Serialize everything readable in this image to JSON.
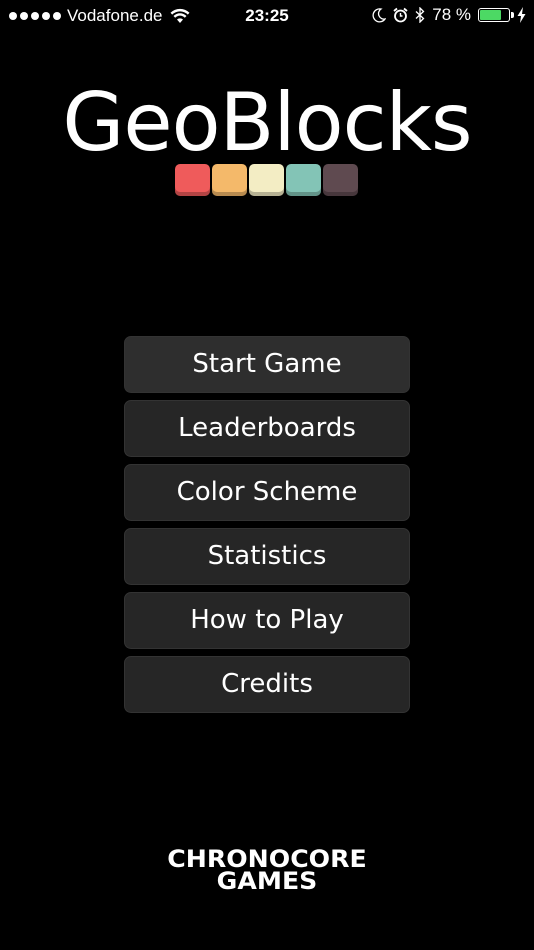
{
  "status_bar": {
    "carrier": "Vodafone.de",
    "time": "23:25",
    "battery_percent_text": "78 %",
    "battery_level": 0.78
  },
  "title": "GeoBlocks",
  "blocks": [
    {
      "color": "#ef5b5b"
    },
    {
      "color": "#f4b96a"
    },
    {
      "color": "#f3edc4"
    },
    {
      "color": "#83c4b6"
    },
    {
      "color": "#5f4a50"
    }
  ],
  "menu": {
    "items": [
      {
        "label": "Start Game"
      },
      {
        "label": "Leaderboards"
      },
      {
        "label": "Color Scheme"
      },
      {
        "label": "Statistics"
      },
      {
        "label": "How to Play"
      },
      {
        "label": "Credits"
      }
    ]
  },
  "publisher": {
    "line1": "CHRONOCORE",
    "line2": "GAMES"
  }
}
